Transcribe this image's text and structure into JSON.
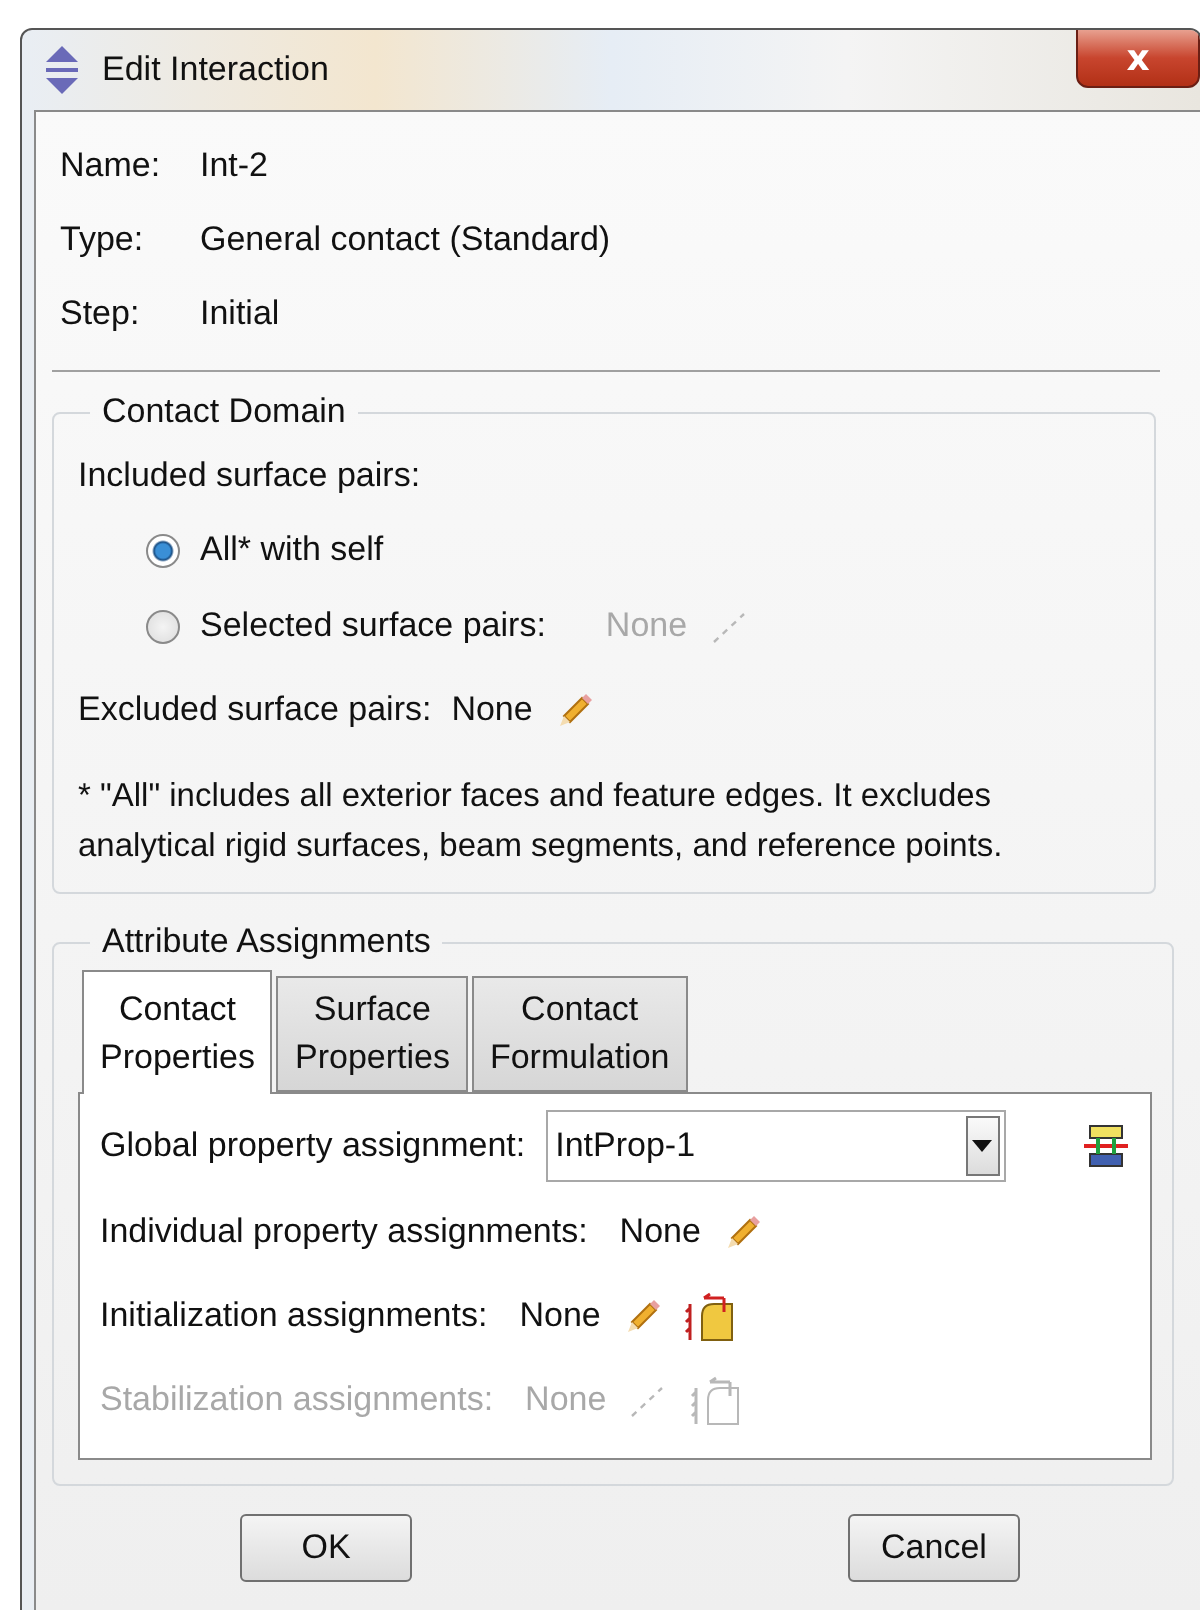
{
  "window": {
    "title": "Edit Interaction",
    "close": "x"
  },
  "info": [
    {
      "label": "Name:",
      "value": "Int-2"
    },
    {
      "label": "Type:",
      "value": "General contact (Standard)"
    },
    {
      "label": "Step:",
      "value": "Initial"
    }
  ],
  "contact_domain": {
    "title": "Contact Domain",
    "included_label": "Included surface pairs:",
    "options": [
      {
        "label": "All* with self",
        "selected": true
      },
      {
        "label": "Selected surface pairs:",
        "selected": false,
        "value": "None",
        "value_disabled": true
      }
    ],
    "excluded": {
      "label": "Excluded surface pairs:",
      "value": "None"
    },
    "note": "* \"All\" includes all exterior faces and feature edges. It excludes analytical rigid surfaces, beam segments, and reference points."
  },
  "attributes": {
    "title": "Attribute Assignments",
    "tabs": [
      {
        "label": "Contact Properties",
        "selected": true
      },
      {
        "label": "Surface Properties",
        "selected": false
      },
      {
        "label": "Contact Formulation",
        "selected": false
      }
    ],
    "global": {
      "label": "Global property assignment:",
      "value": "IntProp-1"
    },
    "rows": [
      {
        "label": "Individual property assignments:",
        "value": "None",
        "disabled": false,
        "extra_icon": false
      },
      {
        "label": "Initialization assignments:",
        "value": "None",
        "disabled": false,
        "extra_icon": true
      },
      {
        "label": "Stabilization assignments:",
        "value": "None",
        "disabled": true,
        "extra_icon": true
      }
    ]
  },
  "buttons": [
    "OK",
    "Cancel"
  ]
}
